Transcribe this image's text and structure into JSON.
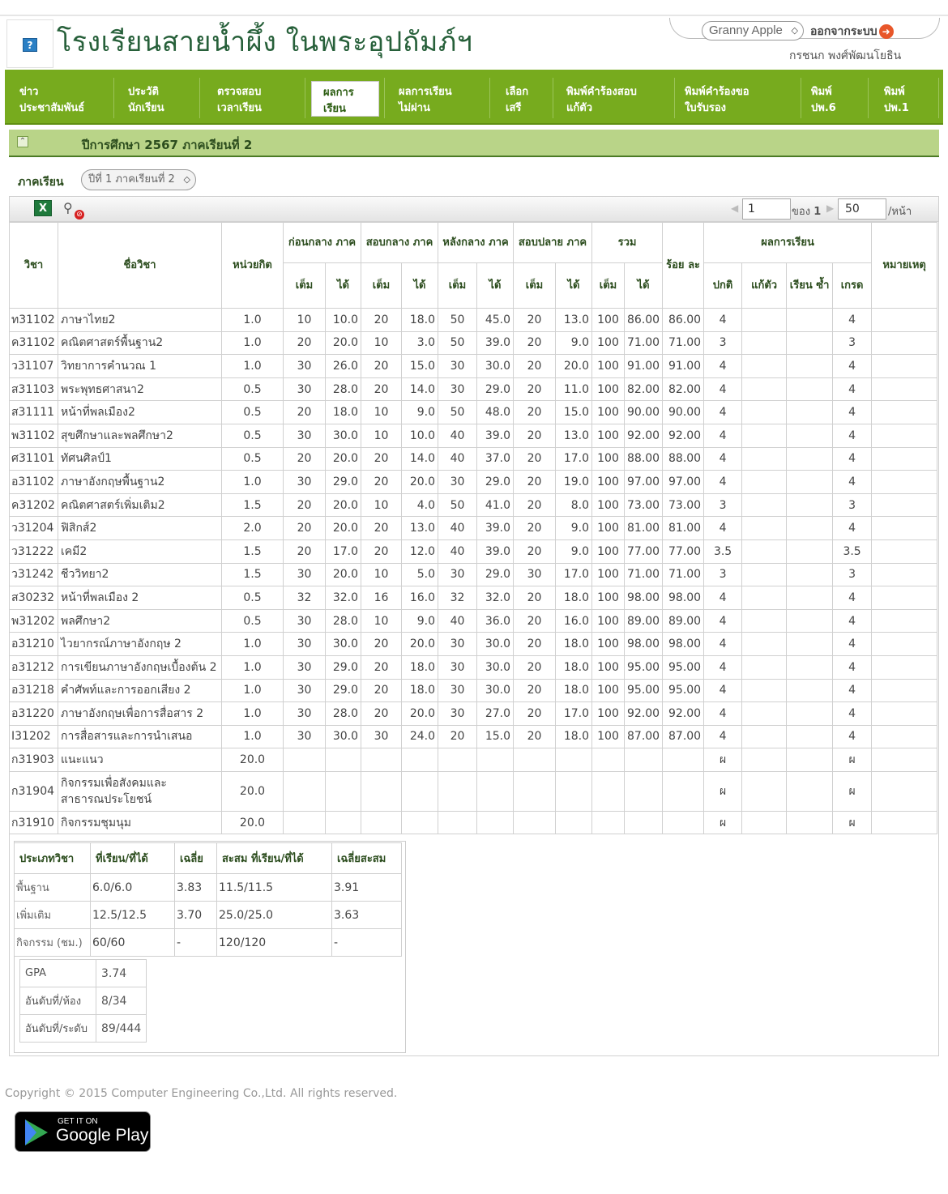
{
  "header": {
    "school_name": "โรงเรียนสายน้ำผึ้ง ในพระอุปถัมภ์ฯ",
    "theme_select": "Granny Apple",
    "logout_label": "ออกจากระบบ",
    "username": "กรชนก พงศ์พัฒนโยธิน"
  },
  "nav": [
    {
      "line1": "ข่าว",
      "line2": "ประชาสัมพันธ์"
    },
    {
      "line1": "ประวัติ",
      "line2": "นักเรียน"
    },
    {
      "line1": "ตรวจสอบ",
      "line2": "เวลาเรียน"
    },
    {
      "line1": "ผลการ",
      "line2": "เรียน"
    },
    {
      "line1": "ผลการเรียน",
      "line2": "ไม่ผ่าน"
    },
    {
      "line1": "เลือก",
      "line2": "เสรี"
    },
    {
      "line1": "พิมพ์คำร้องสอบ",
      "line2": "แก้ตัว"
    },
    {
      "line1": "พิมพ์คำร้องขอ",
      "line2": "ใบรับรอง"
    },
    {
      "line1": "พิมพ์",
      "line2": "ปพ.6"
    },
    {
      "line1": "พิมพ์",
      "line2": "ปพ.1"
    }
  ],
  "year_title": "ปีการศึกษา 2567 ภาคเรียนที่ 2",
  "semester": {
    "label": "ภาคเรียน",
    "value": "ปีที่ 1 ภาคเรียนที่ 2"
  },
  "pager": {
    "page": "1",
    "of_label": "ของ",
    "total": "1",
    "per_page": "50",
    "per_page_label": "/หน้า"
  },
  "table": {
    "headers": {
      "code": "วิชา",
      "name": "ชื่อวิชา",
      "credit": "หน่วยกิต",
      "pre_mid": "ก่อนกลาง ภาค",
      "mid": "สอบกลาง ภาค",
      "post_mid": "หลังกลาง ภาค",
      "final": "สอบปลาย ภาค",
      "total": "รวม",
      "percent": "ร้อย ละ",
      "result": "ผลการเรียน",
      "remark": "หมายเหตุ",
      "full": "เต็ม",
      "got": "ได้",
      "normal": "ปกติ",
      "fix": "แก้ตัว",
      "repeat": "เรียน ซ้ำ",
      "grade": "เกรด"
    },
    "rows": [
      [
        "ท31102",
        "ภาษาไทย2",
        "1.0",
        "10",
        "10.0",
        "20",
        "18.0",
        "50",
        "45.0",
        "20",
        "13.0",
        "100",
        "86.00",
        "86.00",
        "4",
        "",
        "",
        "4",
        ""
      ],
      [
        "ค31102",
        "คณิตศาสตร์พื้นฐาน2",
        "1.0",
        "20",
        "20.0",
        "10",
        "3.0",
        "50",
        "39.0",
        "20",
        "9.0",
        "100",
        "71.00",
        "71.00",
        "3",
        "",
        "",
        "3",
        ""
      ],
      [
        "ว31107",
        "วิทยาการคำนวณ 1",
        "1.0",
        "30",
        "26.0",
        "20",
        "15.0",
        "30",
        "30.0",
        "20",
        "20.0",
        "100",
        "91.00",
        "91.00",
        "4",
        "",
        "",
        "4",
        ""
      ],
      [
        "ส31103",
        "พระพุทธศาสนา2",
        "0.5",
        "30",
        "28.0",
        "20",
        "14.0",
        "30",
        "29.0",
        "20",
        "11.0",
        "100",
        "82.00",
        "82.00",
        "4",
        "",
        "",
        "4",
        ""
      ],
      [
        "ส31111",
        "หน้าที่พลเมือง2",
        "0.5",
        "20",
        "18.0",
        "10",
        "9.0",
        "50",
        "48.0",
        "20",
        "15.0",
        "100",
        "90.00",
        "90.00",
        "4",
        "",
        "",
        "4",
        ""
      ],
      [
        "พ31102",
        "สุขศึกษาและพลศึกษา2",
        "0.5",
        "30",
        "30.0",
        "10",
        "10.0",
        "40",
        "39.0",
        "20",
        "13.0",
        "100",
        "92.00",
        "92.00",
        "4",
        "",
        "",
        "4",
        ""
      ],
      [
        "ศ31101",
        "ทัศนศิลป์1",
        "0.5",
        "20",
        "20.0",
        "20",
        "14.0",
        "40",
        "37.0",
        "20",
        "17.0",
        "100",
        "88.00",
        "88.00",
        "4",
        "",
        "",
        "4",
        ""
      ],
      [
        "อ31102",
        "ภาษาอังกฤษพื้นฐาน2",
        "1.0",
        "30",
        "29.0",
        "20",
        "20.0",
        "30",
        "29.0",
        "20",
        "19.0",
        "100",
        "97.00",
        "97.00",
        "4",
        "",
        "",
        "4",
        ""
      ],
      [
        "ค31202",
        "คณิตศาสตร์เพิ่มเติม2",
        "1.5",
        "20",
        "20.0",
        "10",
        "4.0",
        "50",
        "41.0",
        "20",
        "8.0",
        "100",
        "73.00",
        "73.00",
        "3",
        "",
        "",
        "3",
        ""
      ],
      [
        "ว31204",
        "ฟิสิกส์2",
        "2.0",
        "20",
        "20.0",
        "20",
        "13.0",
        "40",
        "39.0",
        "20",
        "9.0",
        "100",
        "81.00",
        "81.00",
        "4",
        "",
        "",
        "4",
        ""
      ],
      [
        "ว31222",
        "เคมี2",
        "1.5",
        "20",
        "17.0",
        "20",
        "12.0",
        "40",
        "39.0",
        "20",
        "9.0",
        "100",
        "77.00",
        "77.00",
        "3.5",
        "",
        "",
        "3.5",
        ""
      ],
      [
        "ว31242",
        "ชีววิทยา2",
        "1.5",
        "30",
        "20.0",
        "10",
        "5.0",
        "30",
        "29.0",
        "30",
        "17.0",
        "100",
        "71.00",
        "71.00",
        "3",
        "",
        "",
        "3",
        ""
      ],
      [
        "ส30232",
        "หน้าที่พลเมือง 2",
        "0.5",
        "32",
        "32.0",
        "16",
        "16.0",
        "32",
        "32.0",
        "20",
        "18.0",
        "100",
        "98.00",
        "98.00",
        "4",
        "",
        "",
        "4",
        ""
      ],
      [
        "พ31202",
        "พลศึกษา2",
        "0.5",
        "30",
        "28.0",
        "10",
        "9.0",
        "40",
        "36.0",
        "20",
        "16.0",
        "100",
        "89.00",
        "89.00",
        "4",
        "",
        "",
        "4",
        ""
      ],
      [
        "อ31210",
        "ไวยากรณ์ภาษาอังกฤษ 2",
        "1.0",
        "30",
        "30.0",
        "20",
        "20.0",
        "30",
        "30.0",
        "20",
        "18.0",
        "100",
        "98.00",
        "98.00",
        "4",
        "",
        "",
        "4",
        ""
      ],
      [
        "อ31212",
        "การเขียนภาษาอังกฤษเบื้องต้น 2",
        "1.0",
        "30",
        "29.0",
        "20",
        "18.0",
        "30",
        "30.0",
        "20",
        "18.0",
        "100",
        "95.00",
        "95.00",
        "4",
        "",
        "",
        "4",
        ""
      ],
      [
        "อ31218",
        "คำศัพท์และการออกเสียง 2",
        "1.0",
        "30",
        "29.0",
        "20",
        "18.0",
        "30",
        "30.0",
        "20",
        "18.0",
        "100",
        "95.00",
        "95.00",
        "4",
        "",
        "",
        "4",
        ""
      ],
      [
        "อ31220",
        "ภาษาอังกฤษเพื่อการสื่อสาร 2",
        "1.0",
        "30",
        "28.0",
        "20",
        "20.0",
        "30",
        "27.0",
        "20",
        "17.0",
        "100",
        "92.00",
        "92.00",
        "4",
        "",
        "",
        "4",
        ""
      ],
      [
        "I31202",
        "การสื่อสารและการนำเสนอ",
        "1.0",
        "30",
        "30.0",
        "30",
        "24.0",
        "20",
        "15.0",
        "20",
        "18.0",
        "100",
        "87.00",
        "87.00",
        "4",
        "",
        "",
        "4",
        ""
      ],
      [
        "ก31903",
        "แนะแนว",
        "20.0",
        "",
        "",
        "",
        "",
        "",
        "",
        "",
        "",
        "",
        "",
        "",
        "ผ",
        "",
        "",
        "ผ",
        ""
      ],
      [
        "ก31904",
        "กิจกรรมเพื่อสังคมและ\nสาธารณประโยชน์",
        "20.0",
        "",
        "",
        "",
        "",
        "",
        "",
        "",
        "",
        "",
        "",
        "",
        "ผ",
        "",
        "",
        "ผ",
        ""
      ],
      [
        "ก31910",
        "กิจกรรมชุมนุม",
        "20.0",
        "",
        "",
        "",
        "",
        "",
        "",
        "",
        "",
        "",
        "",
        "",
        "ผ",
        "",
        "",
        "ผ",
        ""
      ]
    ]
  },
  "summary": {
    "headers": [
      "ประเภทวิชา",
      "ที่เรียน/ที่ได้",
      "เฉลี่ย",
      "สะสม ที่เรียน/ที่ได้",
      "เฉลี่ยสะสม"
    ],
    "rows": [
      [
        "พื้นฐาน",
        "6.0/6.0",
        "3.83",
        "11.5/11.5",
        "3.91"
      ],
      [
        "เพิ่มเติม",
        "12.5/12.5",
        "3.70",
        "25.0/25.0",
        "3.63"
      ],
      [
        "กิจกรรม (ชม.)",
        "60/60",
        "-",
        "120/120",
        "-"
      ]
    ],
    "gpa": [
      [
        "GPA",
        "3.74"
      ],
      [
        "อันดับที่/ห้อง",
        "8/34"
      ],
      [
        "อันดับที่/ระดับ",
        "89/444"
      ]
    ]
  },
  "footer": {
    "copyright": "Copyright © 2015 Computer Engineering Co.,Ltd. All rights reserved.",
    "store_small": "GET IT ON",
    "store_big": "Google Play"
  }
}
